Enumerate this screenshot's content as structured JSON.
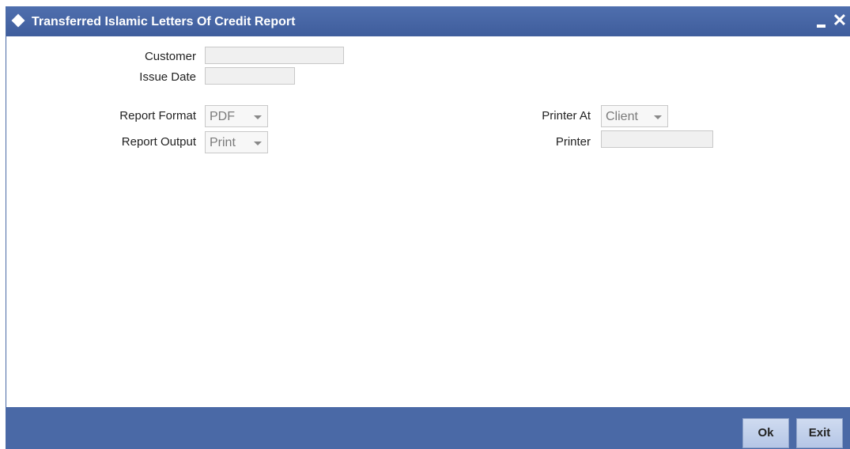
{
  "window": {
    "title": "Transferred Islamic Letters Of Credit Report"
  },
  "form": {
    "customer": {
      "label": "Customer",
      "value": ""
    },
    "issue_date": {
      "label": "Issue Date",
      "value": ""
    },
    "report_format": {
      "label": "Report Format",
      "selected": "PDF"
    },
    "report_output": {
      "label": "Report Output",
      "selected": "Print"
    },
    "printer_at": {
      "label": "Printer At",
      "selected": "Client"
    },
    "printer": {
      "label": "Printer",
      "value": ""
    }
  },
  "footer": {
    "ok_label": "Ok",
    "exit_label": "Exit"
  },
  "colors": {
    "titlebar": "#4a69a6",
    "footer": "#4a69a6",
    "button": "#c3d2ec"
  },
  "icons": {
    "title": "diamond-icon",
    "minimize": "minimize-icon",
    "close": "close-icon",
    "dropdown": "chevron-down-icon"
  }
}
